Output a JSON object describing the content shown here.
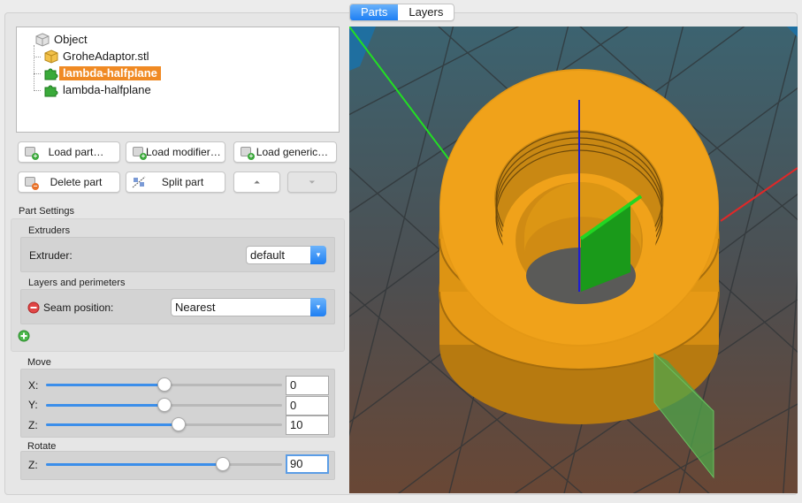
{
  "tabs": [
    {
      "label": "Parts"
    },
    {
      "label": "Layers"
    }
  ],
  "tree": {
    "items": [
      {
        "label": "Object",
        "icon": "object-cube-icon"
      },
      {
        "label": "GroheAdaptor.stl",
        "icon": "part-cube-icon"
      },
      {
        "label": "lambda-halfplane",
        "icon": "modifier-puzzle-icon",
        "selected": true
      },
      {
        "label": "lambda-halfplane",
        "icon": "modifier-puzzle-icon"
      }
    ]
  },
  "buttons": {
    "load_part": "Load part…",
    "load_modifier": "Load modifier…",
    "load_generic": "Load generic…",
    "delete_part": "Delete part",
    "split_part": "Split part",
    "move_up": "⏶",
    "move_down": "⏷"
  },
  "part_settings": {
    "title": "Part Settings",
    "extruders_title": "Extruders",
    "extruder_label": "Extruder:",
    "extruder_value": "default",
    "layers_title": "Layers and perimeters",
    "seam_label": "Seam position:",
    "seam_value": "Nearest"
  },
  "move": {
    "title": "Move",
    "x": {
      "label": "X:",
      "value": "0",
      "fraction": 0.5
    },
    "y": {
      "label": "Y:",
      "value": "0",
      "fraction": 0.5
    },
    "z": {
      "label": "Z:",
      "value": "10",
      "fraction": 0.56
    }
  },
  "rotate": {
    "title": "Rotate",
    "z": {
      "label": "Z:",
      "value": "90",
      "fraction": 0.75
    }
  },
  "colors": {
    "selection": "#f08a24",
    "accent": "#1d7ff4",
    "part_orange": "#e39a14",
    "modifier_green": "#20a020",
    "axis_x": "#e02020",
    "axis_y": "#20e020",
    "axis_z": "#2020d0"
  }
}
